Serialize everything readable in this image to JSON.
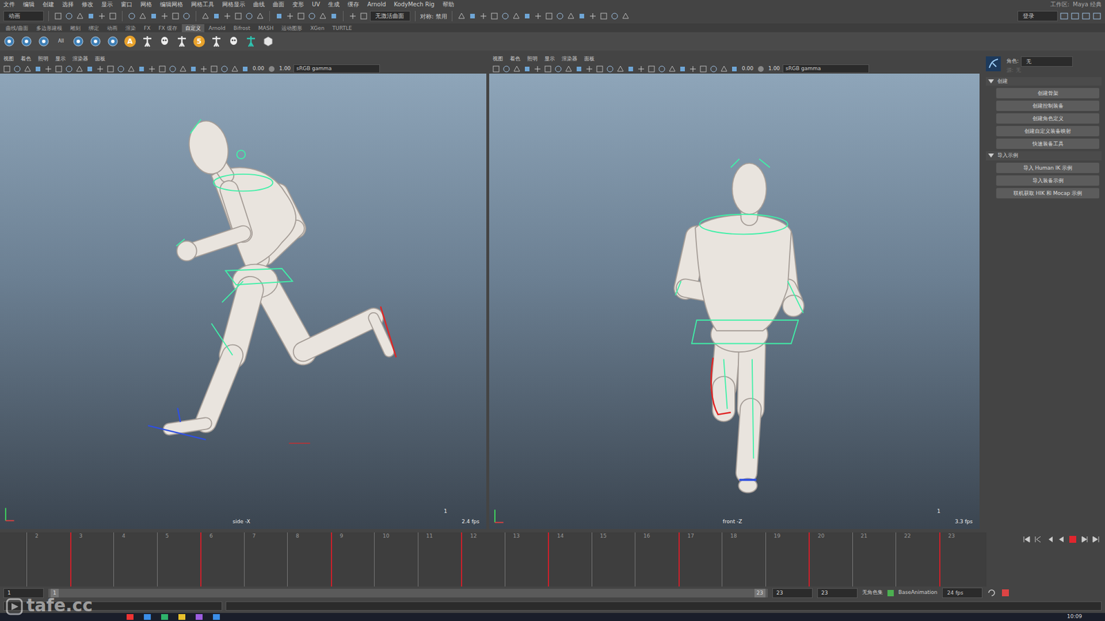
{
  "menubar": {
    "items": [
      "文件",
      "编辑",
      "创建",
      "选择",
      "修改",
      "显示",
      "窗口",
      "网格",
      "编辑网格",
      "网格工具",
      "网格显示",
      "曲线",
      "曲面",
      "变形",
      "UV",
      "生成",
      "缓存",
      "Arnold",
      "KodyMech Rig",
      "帮助"
    ],
    "workspace_label": "工作区:",
    "workspace": "Maya 经典"
  },
  "statusline": {
    "mode": "动画",
    "live_surface": "无激活曲面",
    "symmetry": "对称: 禁用",
    "login": "登录"
  },
  "shelf": {
    "tabs": [
      {
        "label": "曲线/曲面",
        "selected": false
      },
      {
        "label": "多边形建模",
        "selected": false
      },
      {
        "label": "雕刻",
        "selected": false
      },
      {
        "label": "绑定",
        "selected": false
      },
      {
        "label": "动画",
        "selected": false
      },
      {
        "label": "渲染",
        "selected": false
      },
      {
        "label": "FX",
        "selected": false
      },
      {
        "label": "FX 缓存",
        "selected": false
      },
      {
        "label": "自定义",
        "selected": true
      },
      {
        "label": "Arnold",
        "selected": false
      },
      {
        "label": "Bifrost",
        "selected": false
      },
      {
        "label": "MASH",
        "selected": false
      },
      {
        "label": "运动图形",
        "selected": false
      },
      {
        "label": "XGen",
        "selected": false
      },
      {
        "label": "TURTLE",
        "selected": false
      }
    ],
    "items": [
      {
        "kind": "tool"
      },
      {
        "kind": "tool"
      },
      {
        "kind": "tool"
      },
      {
        "kind": "caption",
        "label": "All"
      },
      {
        "kind": "tool"
      },
      {
        "kind": "tool"
      },
      {
        "kind": "tool"
      },
      {
        "kind": "badge",
        "label": "A"
      },
      {
        "kind": "skeleton"
      },
      {
        "kind": "skull"
      },
      {
        "kind": "skeleton"
      },
      {
        "kind": "badge",
        "label": "5"
      },
      {
        "kind": "skeleton"
      },
      {
        "kind": "skull"
      },
      {
        "kind": "skeleton"
      },
      {
        "kind": "cube"
      }
    ]
  },
  "viewport_menus": [
    "视图",
    "着色",
    "照明",
    "显示",
    "渲染器",
    "面板"
  ],
  "viewports": [
    {
      "camera": "side -X",
      "fps": "2.4 fps",
      "frame": "1",
      "exposure": "0.00",
      "gamma": "1.00",
      "colorspace": "sRGB gamma",
      "kind": "side"
    },
    {
      "camera": "front -Z",
      "fps": "3.3 fps",
      "frame": "1",
      "exposure": "0.00",
      "gamma": "1.00",
      "colorspace": "sRGB gamma",
      "kind": "front"
    }
  ],
  "side_panel": {
    "character_label": "角色:",
    "character": "无",
    "source_label": "源:",
    "source": "无",
    "sections": [
      {
        "title": "创建",
        "expanded": true,
        "buttons": [
          "创建骨架",
          "创建控制装备",
          "创建角色定义",
          "创建自定义装备映射",
          "快速装备工具"
        ]
      },
      {
        "title": "导入示例",
        "expanded": true,
        "buttons": [
          "导入 Human IK 示例",
          "导入装备示例",
          "联机获取 HIK 和 Mocap 示例"
        ]
      }
    ]
  },
  "timeline": {
    "ticks": [
      {
        "label": "2",
        "key": false
      },
      {
        "label": "3",
        "key": true
      },
      {
        "label": "4",
        "key": false
      },
      {
        "label": "5",
        "key": false
      },
      {
        "label": "6",
        "key": true
      },
      {
        "label": "7",
        "key": false
      },
      {
        "label": "8",
        "key": false
      },
      {
        "label": "9",
        "key": true
      },
      {
        "label": "10",
        "key": false
      },
      {
        "label": "11",
        "key": false
      },
      {
        "label": "12",
        "key": true
      },
      {
        "label": "13",
        "key": false
      },
      {
        "label": "14",
        "key": true
      },
      {
        "label": "15",
        "key": false
      },
      {
        "label": "16",
        "key": false
      },
      {
        "label": "17",
        "key": true
      },
      {
        "label": "18",
        "key": false
      },
      {
        "label": "19",
        "key": false
      },
      {
        "label": "20",
        "key": true
      },
      {
        "label": "21",
        "key": false
      },
      {
        "label": "22",
        "key": false
      },
      {
        "label": "23",
        "key": true
      }
    ],
    "playing": true
  },
  "range": {
    "start": "1",
    "slider_start": "1",
    "slider_end": "23",
    "end": "23",
    "end_max": "23",
    "character_set": "无角色集",
    "anim_layer": "BaseAnimation",
    "fps": "24 fps"
  },
  "taskbar": {
    "time": "10:09"
  },
  "watermark": "tafe.cc"
}
